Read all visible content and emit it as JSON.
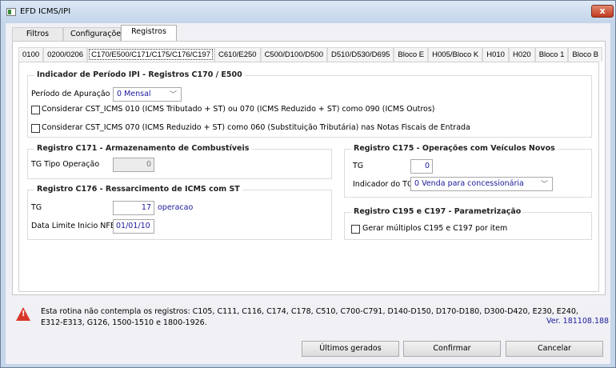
{
  "window": {
    "title": "EFD ICMS/IPI",
    "close": "x"
  },
  "outer_tabs": [
    {
      "label": "Filtros"
    },
    {
      "label": "Configurações"
    },
    {
      "label": "Registros"
    }
  ],
  "inner_tabs": [
    {
      "label": "0100"
    },
    {
      "label": "0200/0206"
    },
    {
      "label": "C170/E500/C171/C175/C176/C197"
    },
    {
      "label": "C610/E250"
    },
    {
      "label": "C500/D100/D500"
    },
    {
      "label": "D510/D530/D695"
    },
    {
      "label": "Bloco E"
    },
    {
      "label": "H005/Bloco K"
    },
    {
      "label": "H010"
    },
    {
      "label": "H020"
    },
    {
      "label": "Bloco 1"
    },
    {
      "label": "Bloco B"
    }
  ],
  "ipi": {
    "title": "Indicador de Período IPI - Registros C170 / E500",
    "periodo_label": "Período de Apuração",
    "periodo_value": "0 Mensal",
    "check1": "Considerar CST_ICMS 010 (ICMS Tributado + ST) ou 070 (ICMS Reduzido + ST) como 090 (ICMS Outros)",
    "check2": "Considerar CST_ICMS 070 (ICMS Reduzido + ST) como 060 (Substituição Tributária) nas Notas Fiscais de Entrada"
  },
  "c171": {
    "title": "Registro C171 - Armazenamento de Combustíveis",
    "tg_label": "TG Tipo Operação",
    "tg_value": "0"
  },
  "c176": {
    "title": "Registro C176 - Ressarcimento de ICMS com ST",
    "tg_label": "TG",
    "tg_value": "17",
    "tg_desc": "operacao",
    "data_label": "Data Limite Inicio NFE",
    "data_value": "01/01/10"
  },
  "c175": {
    "title": "Registro C175 - Operações com Veículos Novos",
    "tg_label": "TG",
    "tg_value": "0",
    "ind_label": "Indicador do TO",
    "ind_value": "0 Venda para concessionária"
  },
  "c195": {
    "title": "Registro C195 e C197 - Parametrização",
    "check": "Gerar múltiplos C195 e C197 por item"
  },
  "footer": {
    "warning_line1": "Esta rotina não contempla os registros: C105, C111, C116, C174, C178, C510, C700-C791, D140-D150, D170-D180, D300-D420, E230, E240,",
    "warning_line2": "E312-E313, G126, 1500-1510 e 1800-1926.",
    "version": "Ver. 181108.188"
  },
  "buttons": {
    "ultimos": "Últimos gerados",
    "confirmar": "Confirmar",
    "cancelar": "Cancelar"
  }
}
